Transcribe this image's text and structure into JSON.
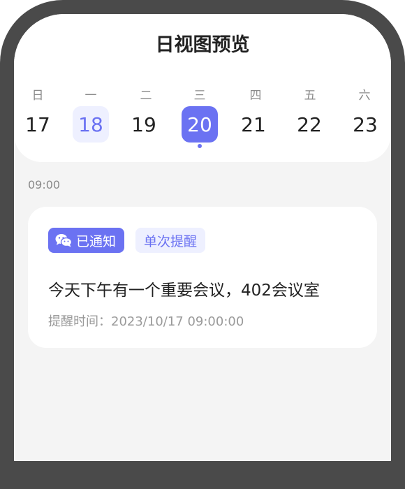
{
  "page": {
    "title": "日视图预览"
  },
  "week": {
    "weekdays": [
      "日",
      "一",
      "二",
      "三",
      "四",
      "五",
      "六"
    ],
    "dates": [
      "17",
      "18",
      "19",
      "20",
      "21",
      "22",
      "23"
    ],
    "today_index": 1,
    "selected_index": 3
  },
  "timeline": {
    "time_label": "09:00"
  },
  "reminder": {
    "badge_notified": "已通知",
    "badge_type": "单次提醒",
    "title": "今天下午有一个重要会议，402会议室",
    "time_label": "提醒时间：",
    "time_value": "2023/10/17 09:00:00"
  },
  "colors": {
    "accent": "#6b72f2",
    "accent_light": "#eef0ff",
    "bezel": "#4a4a4a",
    "background": "#f4f4f4"
  }
}
